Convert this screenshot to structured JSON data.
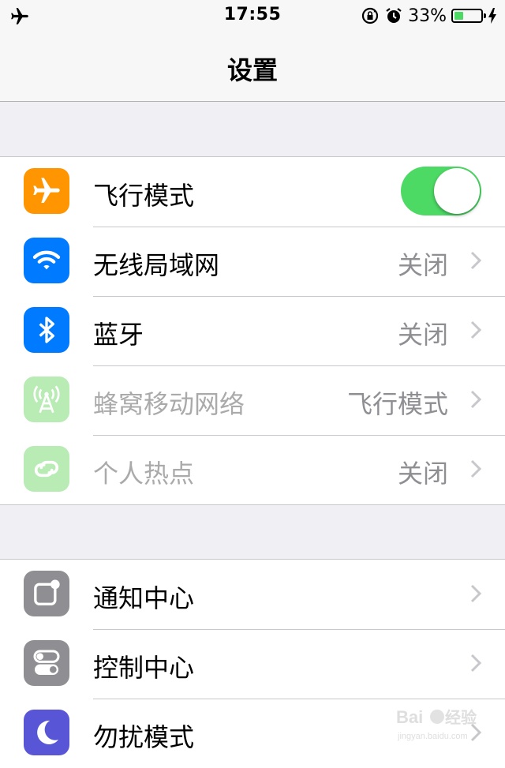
{
  "status_bar": {
    "time": "17:55",
    "battery_percent_text": "33%",
    "battery_level": 0.33,
    "icons": [
      "airplane-icon",
      "orientation-lock-icon",
      "alarm-icon",
      "battery-icon",
      "charging-icon"
    ]
  },
  "nav": {
    "title": "设置"
  },
  "group1": {
    "rows": [
      {
        "label": "飞行模式",
        "icon": "airplane-icon",
        "icon_color": "#ff9500",
        "toggle_on": true
      },
      {
        "label": "无线局域网",
        "value": "关闭",
        "icon": "wifi-icon",
        "icon_color": "#007aff"
      },
      {
        "label": "蓝牙",
        "value": "关闭",
        "icon": "bluetooth-icon",
        "icon_color": "#007aff"
      },
      {
        "label": "蜂窝移动网络",
        "value": "飞行模式",
        "icon": "cellular-icon",
        "icon_color": "#b8ecb4",
        "disabled": true
      },
      {
        "label": "个人热点",
        "value": "关闭",
        "icon": "hotspot-icon",
        "icon_color": "#b8ecb4",
        "disabled": true
      }
    ]
  },
  "group2": {
    "rows": [
      {
        "label": "通知中心",
        "icon": "notification-center-icon",
        "icon_color": "#8e8e93"
      },
      {
        "label": "控制中心",
        "icon": "control-center-icon",
        "icon_color": "#8e8e93"
      },
      {
        "label": "勿扰模式",
        "icon": "moon-icon",
        "icon_color": "#5856d6"
      }
    ]
  },
  "watermark": {
    "text": "Baidu经验",
    "subtext": "jingyan.baidu.com"
  }
}
